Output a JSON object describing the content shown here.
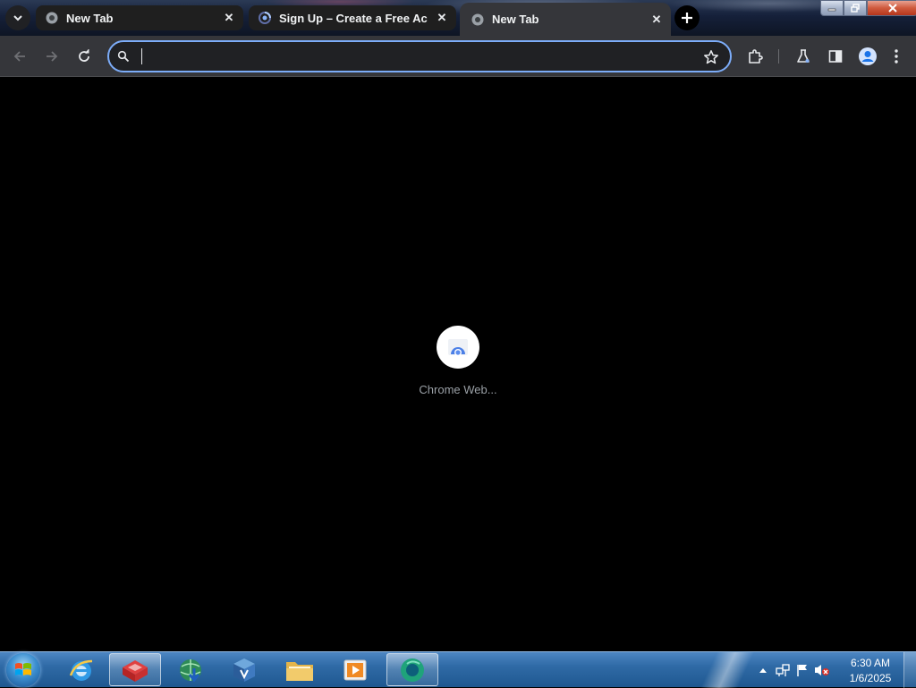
{
  "browser": {
    "tabs": [
      {
        "title": "New Tab",
        "favicon": "chrome-globe-icon",
        "active": false
      },
      {
        "title": "Sign Up – Create a Free Account",
        "favicon": "loading-spinner-icon",
        "active": false
      },
      {
        "title": "New Tab",
        "favicon": "chrome-globe-icon",
        "active": true
      }
    ],
    "tab_close_glyph": "✕",
    "new_tab_glyph": "+",
    "omnibox": {
      "value": "",
      "placeholder": ""
    },
    "toolbar_icons": [
      "back-arrow-icon",
      "forward-arrow-icon",
      "reload-icon",
      "bookmark-star-icon",
      "extensions-puzzle-icon",
      "chrome-labs-flask-icon",
      "side-panel-icon",
      "profile-avatar-icon",
      "more-menu-icon"
    ]
  },
  "content": {
    "loading_label": "Chrome Web..."
  },
  "taskbar": {
    "clock_time": "6:30 AM",
    "clock_date": "1/6/2025",
    "pinned": [
      "internet-explorer-icon",
      "toolbox-app-icon",
      "idm-globe-icon",
      "virtualbox-icon",
      "file-explorer-folder-icon",
      "media-player-icon",
      "chrome-active-icon"
    ]
  },
  "colors": {
    "accent": "#7cacf8",
    "tab_active": "#35363a",
    "tab_inactive": "#1f1f1f",
    "omnibox_bg": "#202124",
    "taskbar": "#2f6aa6"
  }
}
